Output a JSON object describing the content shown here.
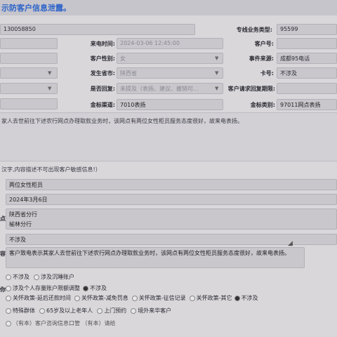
{
  "top_banner": "示防客户信息泄露。",
  "row1": {
    "phone": "130058850",
    "level_label": "专线业务类型:",
    "level_value": "95599"
  },
  "row2": {
    "call_time_label": "来电时间:",
    "call_time_value": "2024-03-06 12:45:00",
    "cust_no_label": "客户号:",
    "cust_no_value": ""
  },
  "row3": {
    "gender_label": "客户性别:",
    "gender_value": "女",
    "source_label": "事件来源:",
    "source_value": "成都95电话"
  },
  "row4": {
    "province_label": "发生省市:",
    "province_value": "陕西省",
    "card_label": "卡号:",
    "card_value": "不涉及"
  },
  "row5": {
    "reply_label": "是否回复:",
    "reply_value": "未提及（表扬、建议、撤销可...",
    "deadline_label": "客户请求回复期限:",
    "deadline_value": ""
  },
  "row6": {
    "channel_label": "金标渠道:",
    "channel_value": "7010表扬",
    "category_label": "金标类别:",
    "category_value": "97011网点表扬"
  },
  "description_top": "家人去世前往下述农行网点办理取款业务时，该网点有两位女性柜员服务态度很好，故来电表扬。",
  "note_hint": "汉字,内容描述不可出现客户敏感信息!）",
  "fields": {
    "f1": "两位女性柜员",
    "f2": "2024年3月6日",
    "f3_line1": "陕西省分行",
    "f3_line2": "榆林分行",
    "f3_marker": "点",
    "f4": "不涉及",
    "f5": "客户致电表示其家人去世前往下述农行网点办理取款业务时，该网点有两位女性柜员服务态度很好，故来电表扬。",
    "f5_marker": "容"
  },
  "options": {
    "row1": [
      "不涉及",
      "涉及沉睡账户"
    ],
    "row2": [
      "涉及个人存量账户限额调整",
      "不涉及"
    ],
    "row2_marker": "你",
    "row3": [
      "关怀政策-延后还款时间",
      "关怀政策-减免罚息",
      "关怀政策-征信记录",
      "关怀政策-其它",
      "不涉及"
    ],
    "row4": [
      "特殊群体",
      "65岁及以上老年人",
      "上门预约",
      "境外来华客户"
    ],
    "row5_partial": "（有本）客户咨询信息口管 （有本）请给"
  }
}
